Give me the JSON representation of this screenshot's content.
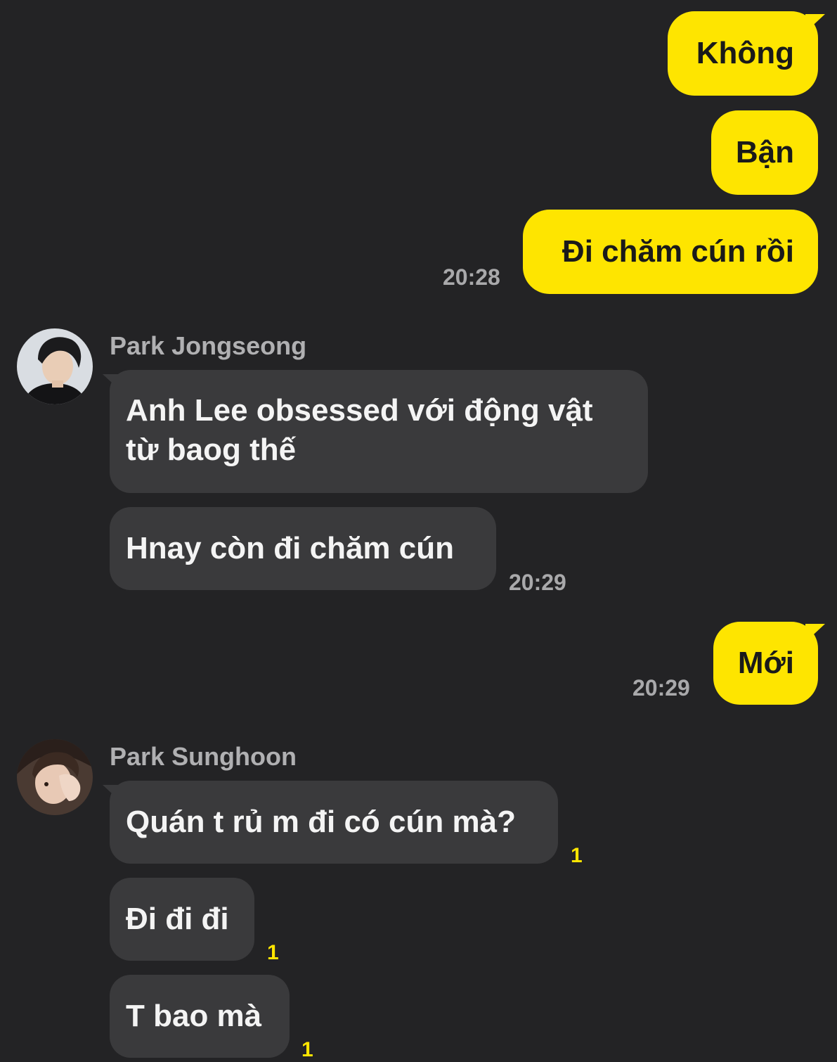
{
  "colors": {
    "background": "#232325",
    "outgoing_bubble": "#fee500",
    "incoming_bubble": "#3a3a3c",
    "unread_count": "#fee500"
  },
  "messages": {
    "out1": {
      "text": "Không"
    },
    "out2": {
      "text": "Bận"
    },
    "out3": {
      "text": "Đi chăm cún rồi",
      "time": "20:28"
    },
    "group1": {
      "sender": "Park Jongseong",
      "avatar": "avatar-jongseong",
      "msg1_line1": "Anh Lee obsessed với động vật",
      "msg1_line2": "từ baog thế",
      "msg2": "Hnay còn đi chăm cún",
      "time": "20:29"
    },
    "out4": {
      "text": "Mới",
      "time": "20:29"
    },
    "group2": {
      "sender": "Park Sunghoon",
      "avatar": "avatar-sunghoon",
      "msg1": "Quán t rủ m đi có cún mà?",
      "msg1_unread": "1",
      "msg2": "Đi đi đi",
      "msg2_unread": "1",
      "msg3": "T bao mà",
      "msg3_unread": "1"
    }
  }
}
